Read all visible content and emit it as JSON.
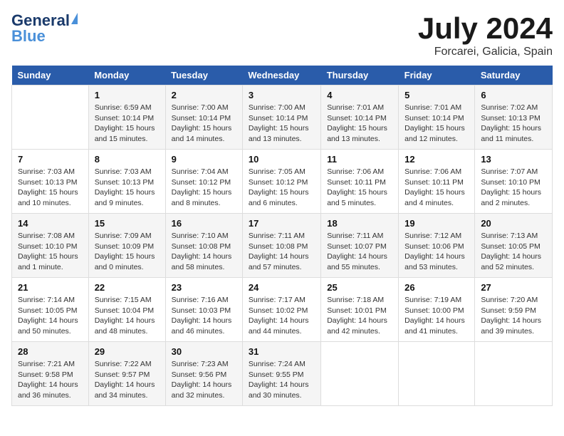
{
  "header": {
    "logo_general": "General",
    "logo_blue": "Blue",
    "month": "July 2024",
    "location": "Forcarei, Galicia, Spain"
  },
  "weekdays": [
    "Sunday",
    "Monday",
    "Tuesday",
    "Wednesday",
    "Thursday",
    "Friday",
    "Saturday"
  ],
  "weeks": [
    [
      {
        "day": "",
        "sunrise": "",
        "sunset": "",
        "daylight": ""
      },
      {
        "day": "1",
        "sunrise": "Sunrise: 6:59 AM",
        "sunset": "Sunset: 10:14 PM",
        "daylight": "Daylight: 15 hours and 15 minutes."
      },
      {
        "day": "2",
        "sunrise": "Sunrise: 7:00 AM",
        "sunset": "Sunset: 10:14 PM",
        "daylight": "Daylight: 15 hours and 14 minutes."
      },
      {
        "day": "3",
        "sunrise": "Sunrise: 7:00 AM",
        "sunset": "Sunset: 10:14 PM",
        "daylight": "Daylight: 15 hours and 13 minutes."
      },
      {
        "day": "4",
        "sunrise": "Sunrise: 7:01 AM",
        "sunset": "Sunset: 10:14 PM",
        "daylight": "Daylight: 15 hours and 13 minutes."
      },
      {
        "day": "5",
        "sunrise": "Sunrise: 7:01 AM",
        "sunset": "Sunset: 10:14 PM",
        "daylight": "Daylight: 15 hours and 12 minutes."
      },
      {
        "day": "6",
        "sunrise": "Sunrise: 7:02 AM",
        "sunset": "Sunset: 10:13 PM",
        "daylight": "Daylight: 15 hours and 11 minutes."
      }
    ],
    [
      {
        "day": "7",
        "sunrise": "Sunrise: 7:03 AM",
        "sunset": "Sunset: 10:13 PM",
        "daylight": "Daylight: 15 hours and 10 minutes."
      },
      {
        "day": "8",
        "sunrise": "Sunrise: 7:03 AM",
        "sunset": "Sunset: 10:13 PM",
        "daylight": "Daylight: 15 hours and 9 minutes."
      },
      {
        "day": "9",
        "sunrise": "Sunrise: 7:04 AM",
        "sunset": "Sunset: 10:12 PM",
        "daylight": "Daylight: 15 hours and 8 minutes."
      },
      {
        "day": "10",
        "sunrise": "Sunrise: 7:05 AM",
        "sunset": "Sunset: 10:12 PM",
        "daylight": "Daylight: 15 hours and 6 minutes."
      },
      {
        "day": "11",
        "sunrise": "Sunrise: 7:06 AM",
        "sunset": "Sunset: 10:11 PM",
        "daylight": "Daylight: 15 hours and 5 minutes."
      },
      {
        "day": "12",
        "sunrise": "Sunrise: 7:06 AM",
        "sunset": "Sunset: 10:11 PM",
        "daylight": "Daylight: 15 hours and 4 minutes."
      },
      {
        "day": "13",
        "sunrise": "Sunrise: 7:07 AM",
        "sunset": "Sunset: 10:10 PM",
        "daylight": "Daylight: 15 hours and 2 minutes."
      }
    ],
    [
      {
        "day": "14",
        "sunrise": "Sunrise: 7:08 AM",
        "sunset": "Sunset: 10:10 PM",
        "daylight": "Daylight: 15 hours and 1 minute."
      },
      {
        "day": "15",
        "sunrise": "Sunrise: 7:09 AM",
        "sunset": "Sunset: 10:09 PM",
        "daylight": "Daylight: 15 hours and 0 minutes."
      },
      {
        "day": "16",
        "sunrise": "Sunrise: 7:10 AM",
        "sunset": "Sunset: 10:08 PM",
        "daylight": "Daylight: 14 hours and 58 minutes."
      },
      {
        "day": "17",
        "sunrise": "Sunrise: 7:11 AM",
        "sunset": "Sunset: 10:08 PM",
        "daylight": "Daylight: 14 hours and 57 minutes."
      },
      {
        "day": "18",
        "sunrise": "Sunrise: 7:11 AM",
        "sunset": "Sunset: 10:07 PM",
        "daylight": "Daylight: 14 hours and 55 minutes."
      },
      {
        "day": "19",
        "sunrise": "Sunrise: 7:12 AM",
        "sunset": "Sunset: 10:06 PM",
        "daylight": "Daylight: 14 hours and 53 minutes."
      },
      {
        "day": "20",
        "sunrise": "Sunrise: 7:13 AM",
        "sunset": "Sunset: 10:05 PM",
        "daylight": "Daylight: 14 hours and 52 minutes."
      }
    ],
    [
      {
        "day": "21",
        "sunrise": "Sunrise: 7:14 AM",
        "sunset": "Sunset: 10:05 PM",
        "daylight": "Daylight: 14 hours and 50 minutes."
      },
      {
        "day": "22",
        "sunrise": "Sunrise: 7:15 AM",
        "sunset": "Sunset: 10:04 PM",
        "daylight": "Daylight: 14 hours and 48 minutes."
      },
      {
        "day": "23",
        "sunrise": "Sunrise: 7:16 AM",
        "sunset": "Sunset: 10:03 PM",
        "daylight": "Daylight: 14 hours and 46 minutes."
      },
      {
        "day": "24",
        "sunrise": "Sunrise: 7:17 AM",
        "sunset": "Sunset: 10:02 PM",
        "daylight": "Daylight: 14 hours and 44 minutes."
      },
      {
        "day": "25",
        "sunrise": "Sunrise: 7:18 AM",
        "sunset": "Sunset: 10:01 PM",
        "daylight": "Daylight: 14 hours and 42 minutes."
      },
      {
        "day": "26",
        "sunrise": "Sunrise: 7:19 AM",
        "sunset": "Sunset: 10:00 PM",
        "daylight": "Daylight: 14 hours and 41 minutes."
      },
      {
        "day": "27",
        "sunrise": "Sunrise: 7:20 AM",
        "sunset": "Sunset: 9:59 PM",
        "daylight": "Daylight: 14 hours and 39 minutes."
      }
    ],
    [
      {
        "day": "28",
        "sunrise": "Sunrise: 7:21 AM",
        "sunset": "Sunset: 9:58 PM",
        "daylight": "Daylight: 14 hours and 36 minutes."
      },
      {
        "day": "29",
        "sunrise": "Sunrise: 7:22 AM",
        "sunset": "Sunset: 9:57 PM",
        "daylight": "Daylight: 14 hours and 34 minutes."
      },
      {
        "day": "30",
        "sunrise": "Sunrise: 7:23 AM",
        "sunset": "Sunset: 9:56 PM",
        "daylight": "Daylight: 14 hours and 32 minutes."
      },
      {
        "day": "31",
        "sunrise": "Sunrise: 7:24 AM",
        "sunset": "Sunset: 9:55 PM",
        "daylight": "Daylight: 14 hours and 30 minutes."
      },
      {
        "day": "",
        "sunrise": "",
        "sunset": "",
        "daylight": ""
      },
      {
        "day": "",
        "sunrise": "",
        "sunset": "",
        "daylight": ""
      },
      {
        "day": "",
        "sunrise": "",
        "sunset": "",
        "daylight": ""
      }
    ]
  ]
}
